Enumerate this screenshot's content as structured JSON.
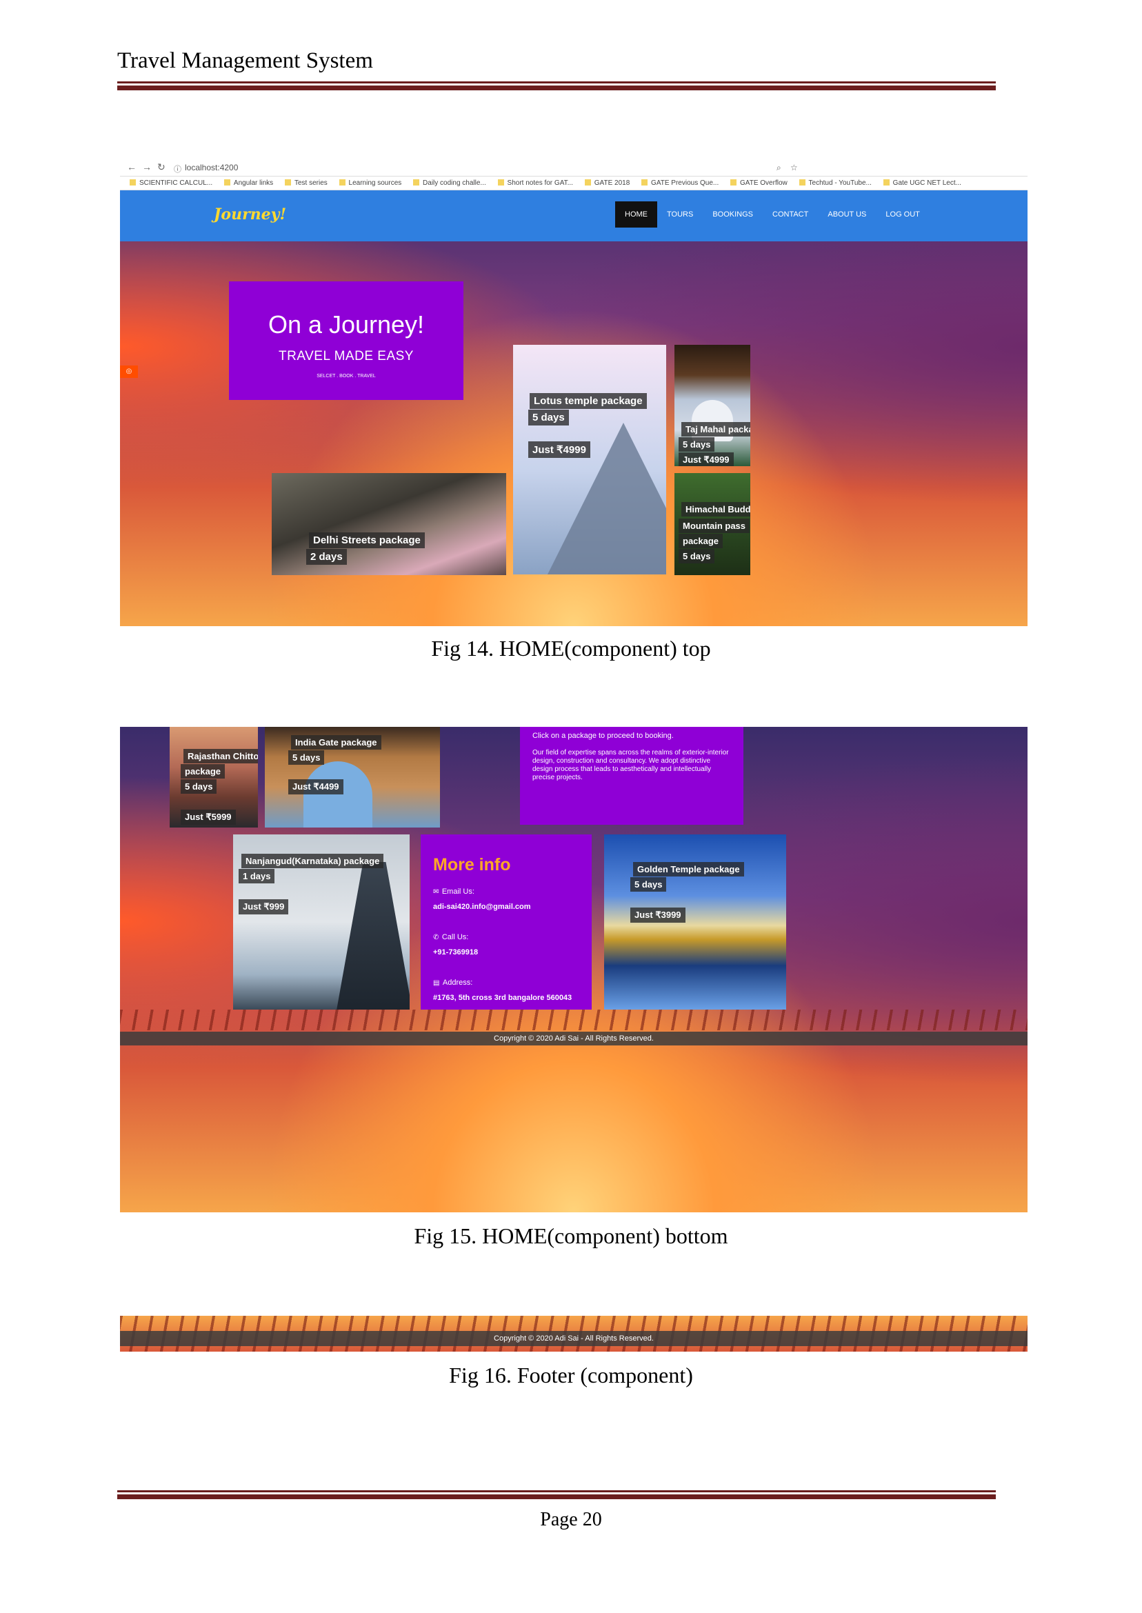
{
  "document": {
    "header": "Travel Management System",
    "page_number": "Page 20"
  },
  "figures": {
    "fig14_caption": "Fig 14. HOME(component) top",
    "fig15_caption": "Fig 15. HOME(component) bottom",
    "fig16_caption": "Fig 16. Footer (component)"
  },
  "browser": {
    "url": "localhost:4200",
    "bookmarks": [
      "SCIENTIFIC CALCUL...",
      "Angular links",
      "Test series",
      "Learning sources",
      "Daily coding challe...",
      "Short notes for GAT...",
      "GATE 2018",
      "GATE Previous Que...",
      "GATE Overflow",
      "Techtud - YouTube...",
      "Gate UGC NET Lect..."
    ]
  },
  "navbar": {
    "brand": "Journey!",
    "items": [
      "HOME",
      "TOURS",
      "BOOKINGS",
      "CONTACT",
      "ABOUT US",
      "LOG OUT"
    ]
  },
  "hero": {
    "title": "On a Journey!",
    "subtitle": "TRAVEL MADE EASY",
    "small": "SELCET . BOOK . TRAVEL"
  },
  "packages_top": {
    "lotus": {
      "name": "Lotus temple package",
      "days": "5 days",
      "price": "Just ₹4999"
    },
    "taj": {
      "name": "Taj Mahal package",
      "days": "5 days",
      "price": "Just ₹4999"
    },
    "delhi": {
      "name": "Delhi Streets package",
      "days": "2 days"
    },
    "himachal": {
      "name1": "Himachal Buddisht",
      "name2": "Mountain pass",
      "name3": "package",
      "days": "5 days"
    }
  },
  "packages_bottom": {
    "rajasthan": {
      "name1": "Rajasthan Chittor Fort",
      "name2": "package",
      "days": "5 days",
      "price": "Just ₹5999"
    },
    "india_gate": {
      "name": "India Gate package",
      "days": "5 days",
      "price": "Just ₹4499"
    },
    "nanjangud": {
      "name": "Nanjangud(Karnataka) package",
      "days": "1 days",
      "price": "Just ₹999"
    },
    "golden": {
      "name": "Golden Temple package",
      "days": "5 days",
      "price": "Just ₹3999"
    }
  },
  "info_panel": {
    "line1": "Click on a package to proceed to booking.",
    "line2": "Our field of expertise spans across the realms of exterior-interior design, construction and consultancy. We adopt distinctive design process that leads to aesthetically and intellectually precise projects."
  },
  "more_info": {
    "title": "More info",
    "email_label": "Email Us:",
    "email": "adi-sai420.info@gmail.com",
    "call_label": "Call Us:",
    "phone": "+91-7369918",
    "address_label": "Address:",
    "address": "#1763, 5th cross 3rd bangalore 560043"
  },
  "footer": {
    "copyright": "Copyright © 2020 Adi Sai - All Rights Reserved."
  },
  "colors": {
    "navbar": "#2f7fe0",
    "panel_purple": "#8f00d6",
    "brand_yellow": "#ffd92f",
    "more_info_orange": "#ffa726",
    "rule": "#6b1f1f"
  }
}
